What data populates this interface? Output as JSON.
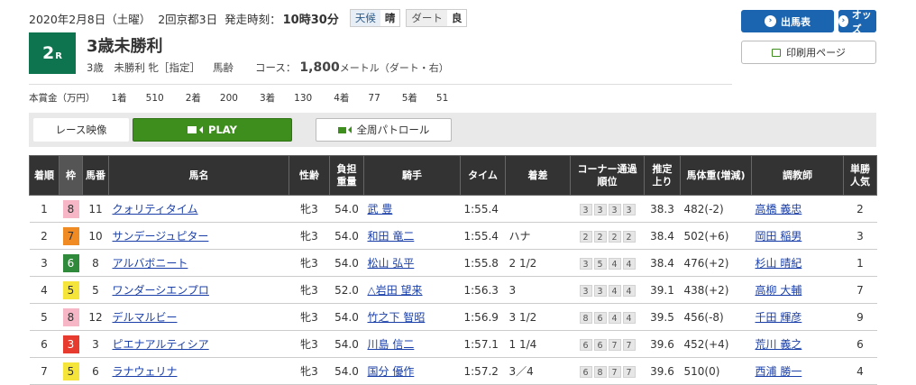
{
  "header": {
    "date": "2020年2月8日（土曜）",
    "meeting": "2回京都3日",
    "post_time_label": "発走時刻：",
    "post_time": "10時30分",
    "weather_label": "天候",
    "weather": "晴",
    "track_label": "ダート",
    "track_condition": "良"
  },
  "race": {
    "number": "2",
    "number_suffix": "R",
    "name": "3歳未勝利",
    "conditions": "3歳　未勝利 牝［指定］",
    "weight_rule": "馬齢",
    "course_label": "コース：",
    "distance": "1,800",
    "distance_unit": "メートル",
    "surface": "（ダート・右）"
  },
  "prize": {
    "label": "本賞金（万円）",
    "items": [
      "1着　　510",
      "2着　　200",
      "3着　　130",
      "4着　　77",
      "5着　　51"
    ]
  },
  "buttons": {
    "entries": "出馬表",
    "odds": "オッズ",
    "print": "印刷用ページ"
  },
  "video": {
    "label": "レース映像",
    "play": "PLAY",
    "patrol": "全周パトロール"
  },
  "table": {
    "headers": [
      "着順",
      "枠",
      "馬番",
      "馬名",
      "性齢",
      "負担重量",
      "騎手",
      "タイム",
      "着差",
      "コーナー通過順位",
      "推定上り",
      "馬体重(増減)",
      "調教師",
      "単勝人気"
    ],
    "rows": [
      {
        "pos": "1",
        "waku": "8",
        "num": "11",
        "horse": "クォリティタイム",
        "sex_age": "牝3",
        "weight": "54.0",
        "jockey": "武 豊",
        "time": "1:55.4",
        "margin": "",
        "corners": [
          "3",
          "3",
          "3",
          "3"
        ],
        "last3f": "38.3",
        "body": "482(-2)",
        "trainer": "高橋 義忠",
        "pop": "2"
      },
      {
        "pos": "2",
        "waku": "7",
        "num": "10",
        "horse": "サンデージュピター",
        "sex_age": "牝3",
        "weight": "54.0",
        "jockey": "和田 竜二",
        "time": "1:55.4",
        "margin": "ハナ",
        "corners": [
          "2",
          "2",
          "2",
          "2"
        ],
        "last3f": "38.4",
        "body": "502(+6)",
        "trainer": "岡田 稲男",
        "pop": "3"
      },
      {
        "pos": "3",
        "waku": "6",
        "num": "8",
        "horse": "アルバボニート",
        "sex_age": "牝3",
        "weight": "54.0",
        "jockey": "松山 弘平",
        "time": "1:55.8",
        "margin": "2 1/2",
        "corners": [
          "3",
          "5",
          "4",
          "4"
        ],
        "last3f": "38.4",
        "body": "476(+2)",
        "trainer": "杉山 晴紀",
        "pop": "1"
      },
      {
        "pos": "4",
        "waku": "5",
        "num": "5",
        "horse": "ワンダーシエンプロ",
        "sex_age": "牝3",
        "weight": "52.0",
        "jockey": "△岩田 望来",
        "time": "1:56.3",
        "margin": "3",
        "corners": [
          "3",
          "3",
          "4",
          "4"
        ],
        "last3f": "39.1",
        "body": "438(+2)",
        "trainer": "高柳 大輔",
        "pop": "7"
      },
      {
        "pos": "5",
        "waku": "8",
        "num": "12",
        "horse": "デルマルビー",
        "sex_age": "牝3",
        "weight": "54.0",
        "jockey": "竹之下 智昭",
        "time": "1:56.9",
        "margin": "3 1/2",
        "corners": [
          "8",
          "6",
          "4",
          "4"
        ],
        "last3f": "39.5",
        "body": "456(-8)",
        "trainer": "千田 輝彦",
        "pop": "9"
      },
      {
        "pos": "6",
        "waku": "3",
        "num": "3",
        "horse": "ピエナアルティシア",
        "sex_age": "牝3",
        "weight": "54.0",
        "jockey": "川島 信二",
        "time": "1:57.1",
        "margin": "1 1/4",
        "corners": [
          "6",
          "6",
          "7",
          "7"
        ],
        "last3f": "39.6",
        "body": "452(+4)",
        "trainer": "荒川 義之",
        "pop": "6"
      },
      {
        "pos": "7",
        "waku": "5",
        "num": "6",
        "horse": "ラナウェリナ",
        "sex_age": "牝3",
        "weight": "54.0",
        "jockey": "国分 優作",
        "time": "1:57.2",
        "margin": "3／4",
        "corners": [
          "6",
          "8",
          "7",
          "7"
        ],
        "last3f": "39.6",
        "body": "510(0)",
        "trainer": "西浦 勝一",
        "pop": "4"
      }
    ]
  },
  "colors": {
    "badge": "#0e7450",
    "blue_button": "#1a64b0",
    "play": "#3e8e1e",
    "header_bg": "#333333",
    "link": "#1a3fa8",
    "waku": {
      "1": {
        "bg": "#ffffff",
        "fg": "#333333"
      },
      "2": {
        "bg": "#222222",
        "fg": "#ffffff"
      },
      "3": {
        "bg": "#e63b2e",
        "fg": "#ffffff"
      },
      "4": {
        "bg": "#2f6fc6",
        "fg": "#ffffff"
      },
      "5": {
        "bg": "#f5e43a",
        "fg": "#333333"
      },
      "6": {
        "bg": "#2f8a3c",
        "fg": "#ffffff"
      },
      "7": {
        "bg": "#f08a22",
        "fg": "#333333"
      },
      "8": {
        "bg": "#f7b6c6",
        "fg": "#333333"
      }
    }
  }
}
